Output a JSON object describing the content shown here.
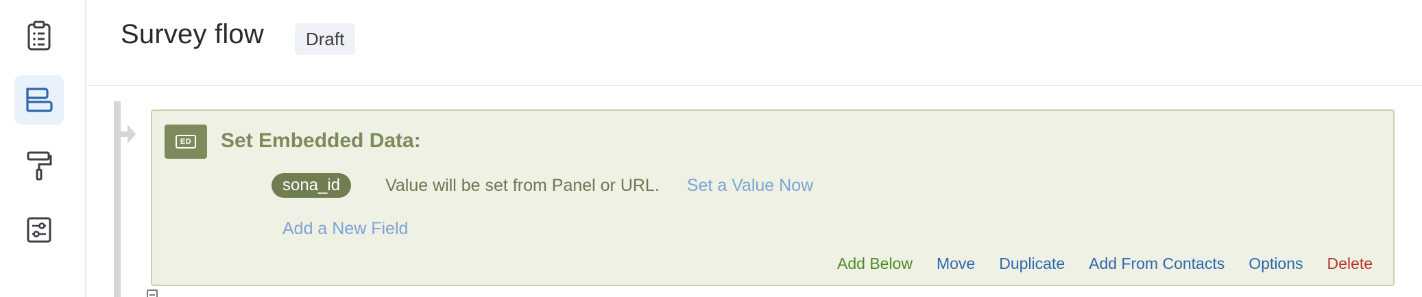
{
  "header": {
    "title": "Survey flow",
    "status": "Draft"
  },
  "rail": {
    "items": [
      {
        "icon": "clipboard-list-icon",
        "active": false
      },
      {
        "icon": "survey-flow-icon",
        "active": true
      },
      {
        "icon": "paint-roller-icon",
        "active": false
      },
      {
        "icon": "sliders-settings-icon",
        "active": false
      }
    ]
  },
  "block": {
    "badge": "ED",
    "title": "Set Embedded Data:",
    "fields": [
      {
        "name": "sona_id",
        "description": "Value will be set from Panel or URL.",
        "set_value_label": "Set a Value Now"
      }
    ],
    "add_field_label": "Add a New Field",
    "actions": {
      "add_below": "Add Below",
      "move": "Move",
      "duplicate": "Duplicate",
      "add_from_contacts": "Add From Contacts",
      "options": "Options",
      "delete": "Delete"
    }
  },
  "colors": {
    "block_bg": "#eef1e3",
    "block_accent": "#7c8a5c",
    "link": "#7ea3d6",
    "add_below": "#4c8a25",
    "action_link": "#2f66ad",
    "delete": "#b6372b",
    "rail_active_bg": "#e9f1fb"
  }
}
